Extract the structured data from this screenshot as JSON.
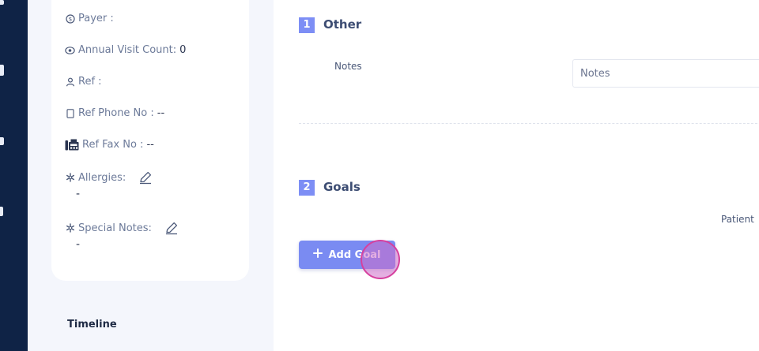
{
  "sidebar": {
    "icons": [
      "nav-icon-1",
      "nav-icon-2",
      "nav-icon-3",
      "nav-icon-4"
    ]
  },
  "patient_info": {
    "payer": {
      "label": "Payer :",
      "value": "",
      "icon": "dollar-circle-icon"
    },
    "annual_visit_count": {
      "label": "Annual Visit Count:",
      "value": "0",
      "icon": "eye-icon"
    },
    "ref": {
      "label": "Ref :",
      "value": "",
      "icon": "person-icon"
    },
    "ref_phone": {
      "label": "Ref Phone No :",
      "value": "--",
      "icon": "phone-icon"
    },
    "ref_fax": {
      "label": "Ref Fax No :",
      "value": "--",
      "icon": "fax-icon"
    },
    "allergies": {
      "label": "Allergies:",
      "value": "-",
      "icon": "asterisk-icon",
      "edit_icon": "pencil-icon"
    },
    "special_notes": {
      "label": "Special Notes:",
      "value": "-",
      "icon": "asterisk-icon",
      "edit_icon": "pencil-icon"
    }
  },
  "timeline": {
    "label": "Timeline"
  },
  "sections": {
    "other": {
      "number": "1",
      "title": "Other",
      "notes_label": "Notes",
      "notes_placeholder": "Notes"
    },
    "goals": {
      "number": "2",
      "title": "Goals",
      "patient_label": "Patient",
      "add_goal_label": "Add Goal",
      "add_icon": "plus-icon"
    }
  },
  "colors": {
    "sidebar": "#0f2346",
    "accent": "#7d8ef5",
    "panel_bg": "#f4f6fc",
    "click_marker": "#d6409e"
  }
}
